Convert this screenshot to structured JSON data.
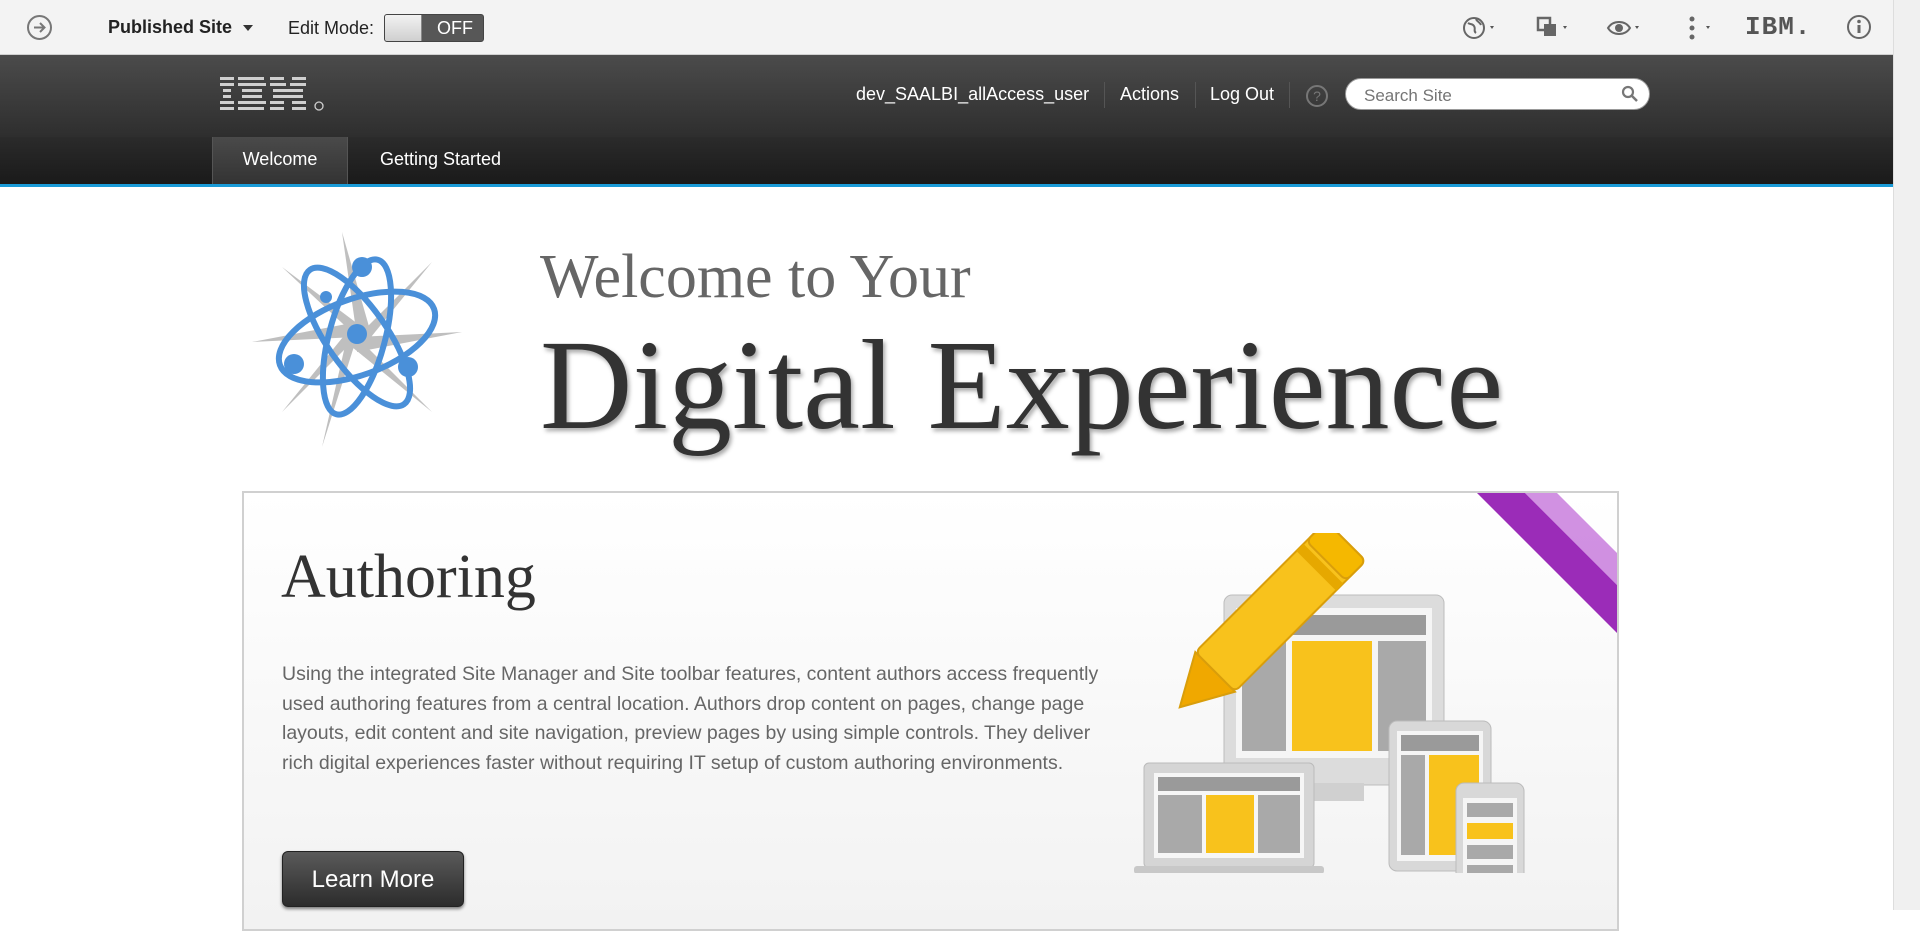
{
  "toolbar": {
    "site_selector": "Published Site",
    "edit_mode_label": "Edit Mode:",
    "edit_mode_state": "OFF",
    "brand": "IBM."
  },
  "header": {
    "user_name": "dev_SAALBI_allAccess_user",
    "actions_label": "Actions",
    "logout_label": "Log Out",
    "search_placeholder": "Search Site"
  },
  "nav": {
    "tabs": [
      {
        "label": "Welcome",
        "active": true
      },
      {
        "label": "Getting Started",
        "active": false
      }
    ]
  },
  "hero": {
    "line1": "Welcome to Your",
    "line2": "Digital Experience"
  },
  "card": {
    "title": "Authoring",
    "body": "Using the integrated Site Manager and Site toolbar features, content authors access frequently used authoring features from a central location. Authors drop content on pages, change page layouts, edit content and site navigation, preview pages by using simple controls. They deliver rich digital experiences faster without requiring IT setup of custom authoring environments.",
    "button": "Learn More"
  },
  "colors": {
    "accent_blue": "#1a9bd7",
    "ribbon_purple": "#9b2cb8",
    "highlight_yellow": "#f8c21c"
  }
}
